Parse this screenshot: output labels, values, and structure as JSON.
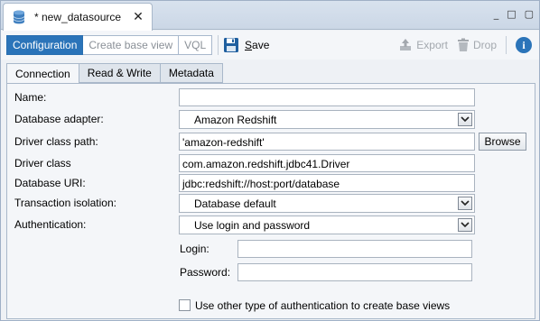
{
  "editor_tab": {
    "title": "* new_datasource",
    "close": "✕"
  },
  "window_controls": {
    "minimize": "_",
    "restore": "□",
    "maximize": "▢"
  },
  "view_switch": [
    {
      "label": "Configuration",
      "active": true
    },
    {
      "label": "Create base view",
      "active": false
    },
    {
      "label": "VQL",
      "active": false
    }
  ],
  "toolbar": {
    "save_label_first": "S",
    "save_label_rest": "ave",
    "export_label": "Export",
    "drop_label": "Drop",
    "info_label": "i"
  },
  "inner_tabs": [
    {
      "label": "Connection",
      "active": true
    },
    {
      "label": "Read & Write",
      "active": false
    },
    {
      "label": "Metadata",
      "active": false
    }
  ],
  "form": {
    "name": {
      "label": "Name:",
      "value": ""
    },
    "database_adapter": {
      "label": "Database adapter:",
      "value": "Amazon Redshift"
    },
    "driver_class_path": {
      "label": "Driver class path:",
      "value": "'amazon-redshift'",
      "browse": "Browse"
    },
    "driver_class": {
      "label": "Driver class",
      "value": "com.amazon.redshift.jdbc41.Driver"
    },
    "database_uri": {
      "label": "Database URI:",
      "value": "jdbc:redshift://host:port/database"
    },
    "transaction_isolation": {
      "label": "Transaction isolation:",
      "value": "Database default"
    },
    "authentication": {
      "label": "Authentication:",
      "value": "Use login and password"
    },
    "login": {
      "label": "Login:",
      "value": ""
    },
    "password": {
      "label": "Password:",
      "value": ""
    },
    "other_auth": {
      "label": "Use other type of authentication to create base views",
      "checked": false
    }
  },
  "colors": {
    "accent": "#2b74b9",
    "panel_bg": "#f4f6f9",
    "tabbar_bg": "#cbd7e6",
    "disabled_text": "#a3a8ae"
  }
}
